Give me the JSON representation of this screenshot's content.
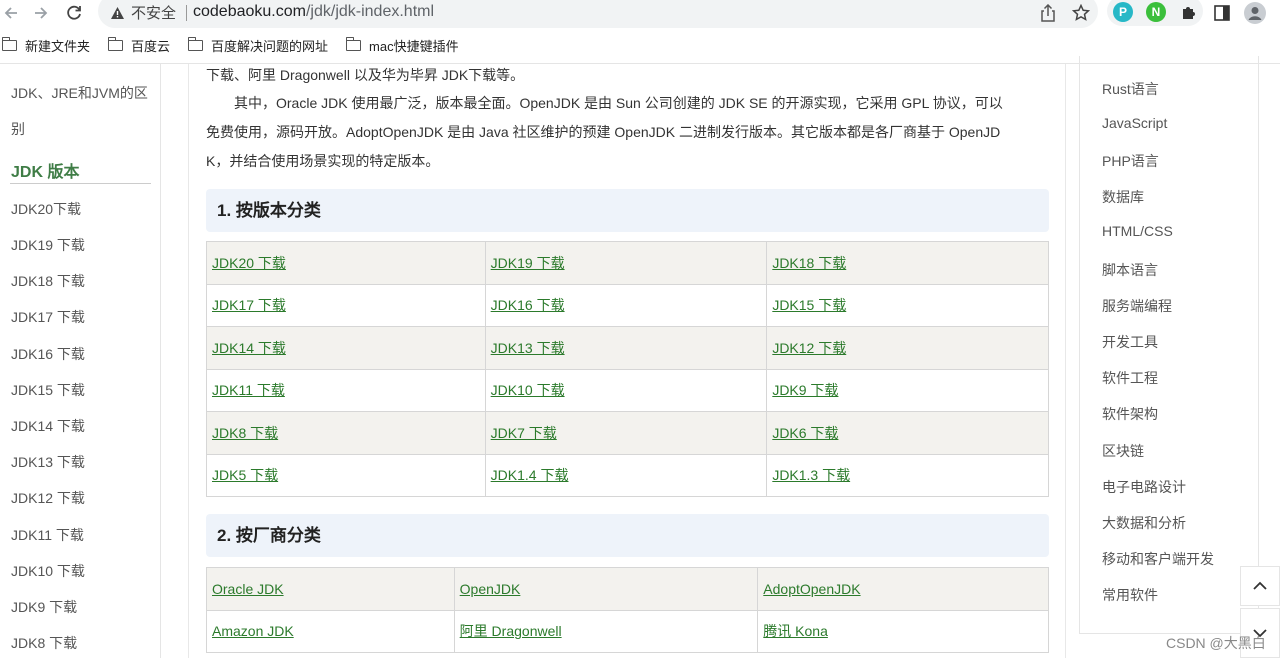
{
  "browser": {
    "security_label": "不安全",
    "url_host": "codebaoku.com",
    "url_path": "/jdk/jdk-index.html",
    "extensions": [
      {
        "name": "P",
        "color": "#27b8c7"
      },
      {
        "name": "N",
        "color": "#3bbf3b"
      }
    ]
  },
  "bookmarks": [
    "新建文件夹",
    "百度云",
    "百度解决问题的网址",
    "mac快捷键插件"
  ],
  "left_nav": {
    "items_top": [
      "JDK、JRE和JVM的区",
      "别"
    ],
    "active": "JDK 版本",
    "items": [
      "JDK20下载",
      "JDK19 下载",
      "JDK18 下载",
      "JDK17 下载",
      "JDK16 下载",
      "JDK15 下载",
      "JDK14 下载",
      "JDK13 下载",
      "JDK12 下载",
      "JDK11 下载",
      "JDK10 下载",
      "JDK9 下载",
      "JDK8 下载"
    ]
  },
  "main": {
    "intro_line1": "下载、阿里 Dragonwell 以及华为毕昇 JDK下载等。",
    "intro_line2": "其中，Oracle JDK 使用最广泛，版本最全面。OpenJDK 是由 Sun 公司创建的 JDK SE 的开源实现，它采用 GPL 协议，可以",
    "intro_line3": "免费使用，源码开放。AdoptOpenJDK 是由 Java 社区维护的预建 OpenJDK 二进制发行版本。其它版本都是各厂商基于 OpenJD",
    "intro_line4": "K，并结合使用场景实现的特定版本。",
    "section1_title": "1. 按版本分类",
    "versions": [
      [
        "JDK20 下载",
        "JDK19 下载",
        "JDK18 下载"
      ],
      [
        "JDK17 下载",
        "JDK16 下载",
        "JDK15 下载"
      ],
      [
        "JDK14 下载",
        "JDK13 下载",
        "JDK12 下载"
      ],
      [
        "JDK11 下载",
        "JDK10 下载",
        "JDK9 下载"
      ],
      [
        "JDK8 下载",
        "JDK7 下载",
        "JDK6 下载"
      ],
      [
        "JDK5 下载",
        "JDK1.4 下载",
        "JDK1.3 下载"
      ]
    ],
    "section2_title": "2. 按厂商分类",
    "vendors": [
      [
        "Oracle JDK",
        "OpenJDK",
        "AdoptOpenJDK"
      ],
      [
        "Amazon JDK",
        "阿里 Dragonwell",
        "腾讯 Kona"
      ]
    ]
  },
  "right_nav": [
    "Rust语言",
    "JavaScript",
    "PHP语言",
    "数据库",
    "HTML/CSS",
    "脚本语言",
    "服务端编程",
    "开发工具",
    "软件工程",
    "软件架构",
    "区块链",
    "电子电路设计",
    "大数据和分析",
    "移动和客户端开发",
    "常用软件"
  ],
  "watermark": "CSDN @大黑白"
}
